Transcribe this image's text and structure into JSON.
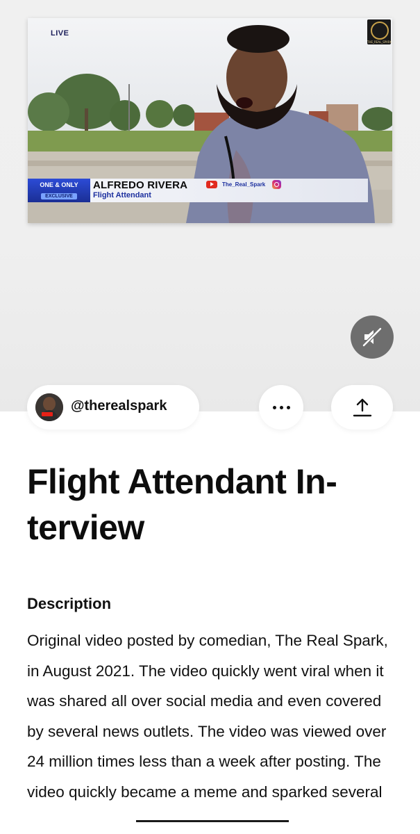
{
  "video": {
    "live_label": "LIVE",
    "channel_logo_text": "THE_REAL_SPARK",
    "badge_line1": "ONE & ONLY",
    "badge_line2": "EXCLUSIVE",
    "lower_third_name": "ALFREDO RIVERA",
    "lower_third_title": "Flight Attendant",
    "lower_third_handle": "The_Real_Spark",
    "mute_icon": "speaker-muted-icon"
  },
  "author": {
    "handle": "@therealspark",
    "avatar_icon": "user-avatar"
  },
  "actions": {
    "more_icon": "more-dots-icon",
    "share_icon": "share-upload-icon"
  },
  "page": {
    "title": "Flight Attendant In-terview"
  },
  "description": {
    "label": "Description",
    "body": "Original video posted by comedian, The Real Spark, in August 2021. The video quickly went viral when it was shared all over social media and even covered by several news outlets. The video was viewed over 24 million times less than a week after posting. The video quickly became a meme and sparked several"
  },
  "colors": {
    "background": "#ffffff",
    "text": "#111111",
    "mute_button": "#6e6e6e",
    "lower_third_accent": "#1c2f9e"
  }
}
